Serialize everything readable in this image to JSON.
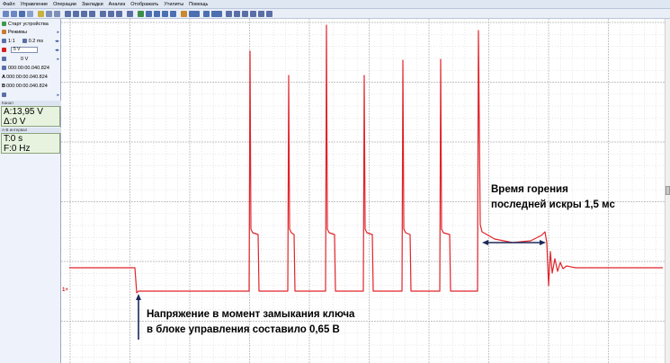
{
  "menu": [
    "Файл",
    "Управление",
    "Операции",
    "Закладки",
    "Анализ",
    "Отображать",
    "Утилиты",
    "Помощь"
  ],
  "left_panel": {
    "start_label": "Старт устройства",
    "modes_label": "Режимы",
    "timebase": "1:1",
    "time_per_div": "0.2 ms",
    "channel_scale": "5 V",
    "trigger_level": "0 V",
    "time_a": "000:00:00.040.824",
    "cursor_a": "A",
    "time_a2": "000:00:00.040.824",
    "cursor_b": "B",
    "time_b": "000:00:00.040.824",
    "box1_caption": "Канал",
    "a_value": "A:13,95 V",
    "delta_value": "Δ:0 V",
    "box2_caption": "А-В интервал",
    "t_value": "T:0 s",
    "f_value": "F:0 Hz"
  },
  "channel_marker": "1+",
  "annotations": {
    "burn_line1": "Время горения",
    "burn_line2": "последней искры 1,5 мс",
    "close_line1": "Напряжение в момент замыкания ключа",
    "close_line2": "в блоке управления составило 0,65 В"
  },
  "colors": {
    "trace": "#e0242a",
    "grid_major": "#b4b4b4",
    "grid_minor": "#d8d8d8",
    "arrow": "#1c2a5a"
  }
}
